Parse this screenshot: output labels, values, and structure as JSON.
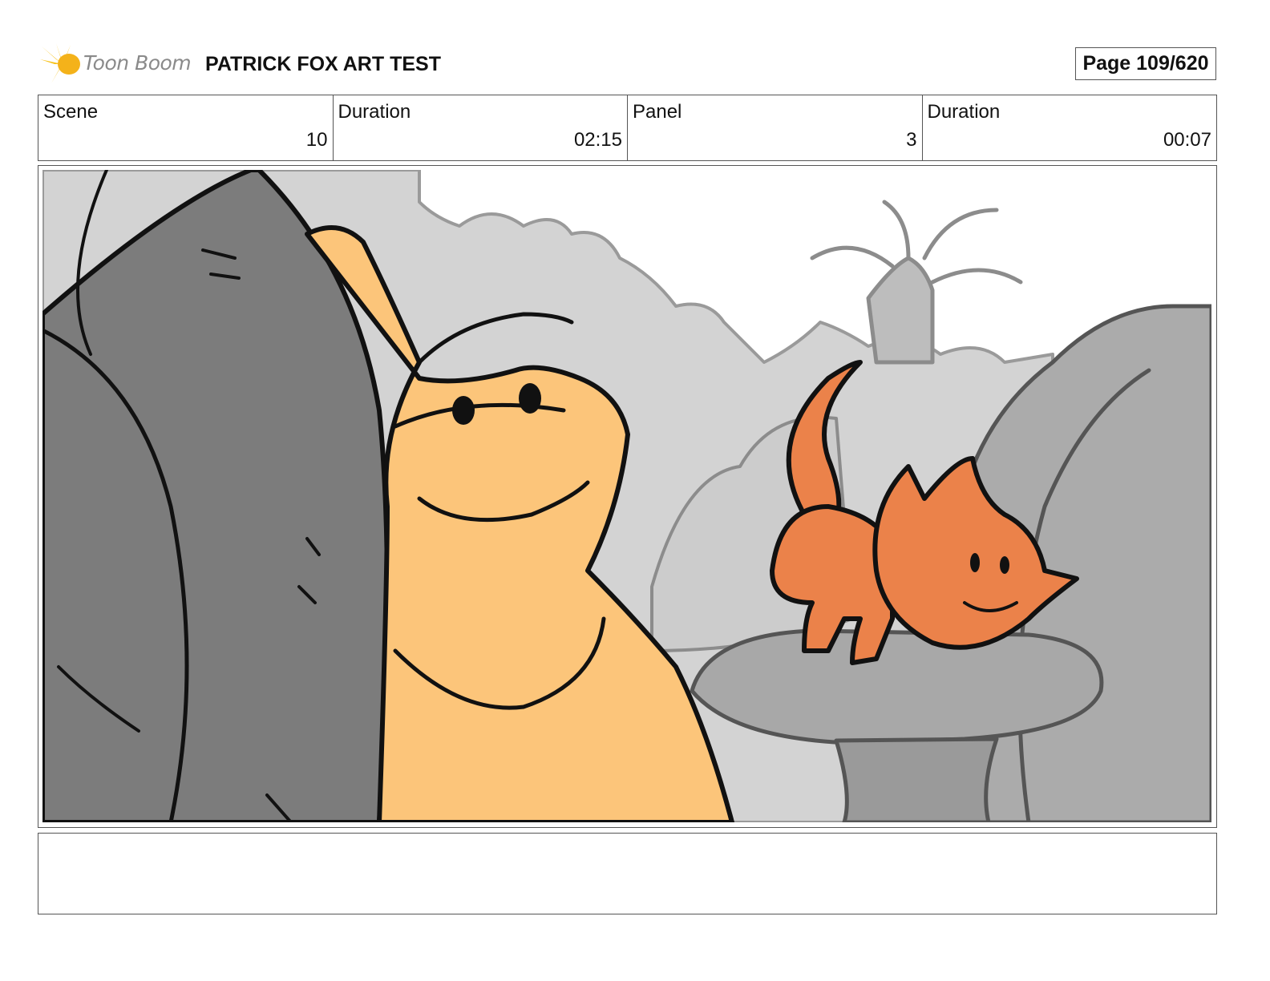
{
  "header": {
    "logo_text": "Toon Boom",
    "title": "PATRICK FOX ART TEST",
    "page": "Page 109/620"
  },
  "info": {
    "scene_label": "Scene",
    "scene_value": "10",
    "scene_duration_label": "Duration",
    "scene_duration_value": "02:15",
    "panel_label": "Panel",
    "panel_value": "3",
    "panel_duration_label": "Duration",
    "panel_duration_value": "00:07"
  },
  "colors": {
    "turtle": "#fcc57a",
    "fox": "#eb824a",
    "shell": "#7c7c7c",
    "background": "#d3d3d3",
    "rock": "#a9a9a9"
  },
  "notes": ""
}
